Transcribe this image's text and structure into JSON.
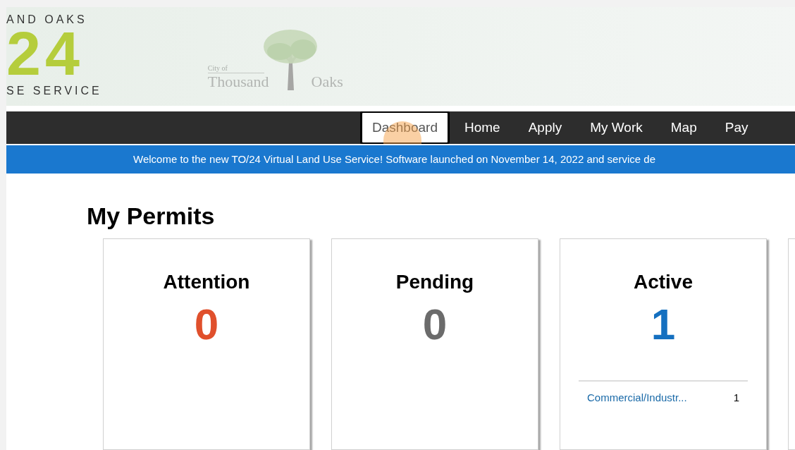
{
  "header": {
    "logo": {
      "top_line": "AND OAKS",
      "number": "24",
      "bottom_line": "SE SERVICE"
    },
    "city_logo": {
      "small": "City of",
      "left_word": "Thousand",
      "right_word": "Oaks"
    }
  },
  "nav": [
    {
      "label": "Dashboard",
      "selected": true
    },
    {
      "label": "Home",
      "selected": false
    },
    {
      "label": "Apply",
      "selected": false
    },
    {
      "label": "My Work",
      "selected": false
    },
    {
      "label": "Map",
      "selected": false
    },
    {
      "label": "Pay",
      "selected": false
    }
  ],
  "banner": "Welcome to the new TO/24 Virtual Land Use Service! Software launched on November 14, 2022 and service de",
  "page_title": "My Permits",
  "cards": [
    {
      "kind": "count",
      "title": "Attention",
      "count": "0",
      "color": "#e0502c"
    },
    {
      "kind": "count",
      "title": "Pending",
      "count": "0",
      "color": "#6b6b6b"
    },
    {
      "kind": "count",
      "title": "Active",
      "count": "1",
      "color": "#1570c0",
      "items": [
        {
          "label": "Commercial/Industr...",
          "count": "1"
        }
      ]
    },
    {
      "kind": "cut"
    }
  ]
}
